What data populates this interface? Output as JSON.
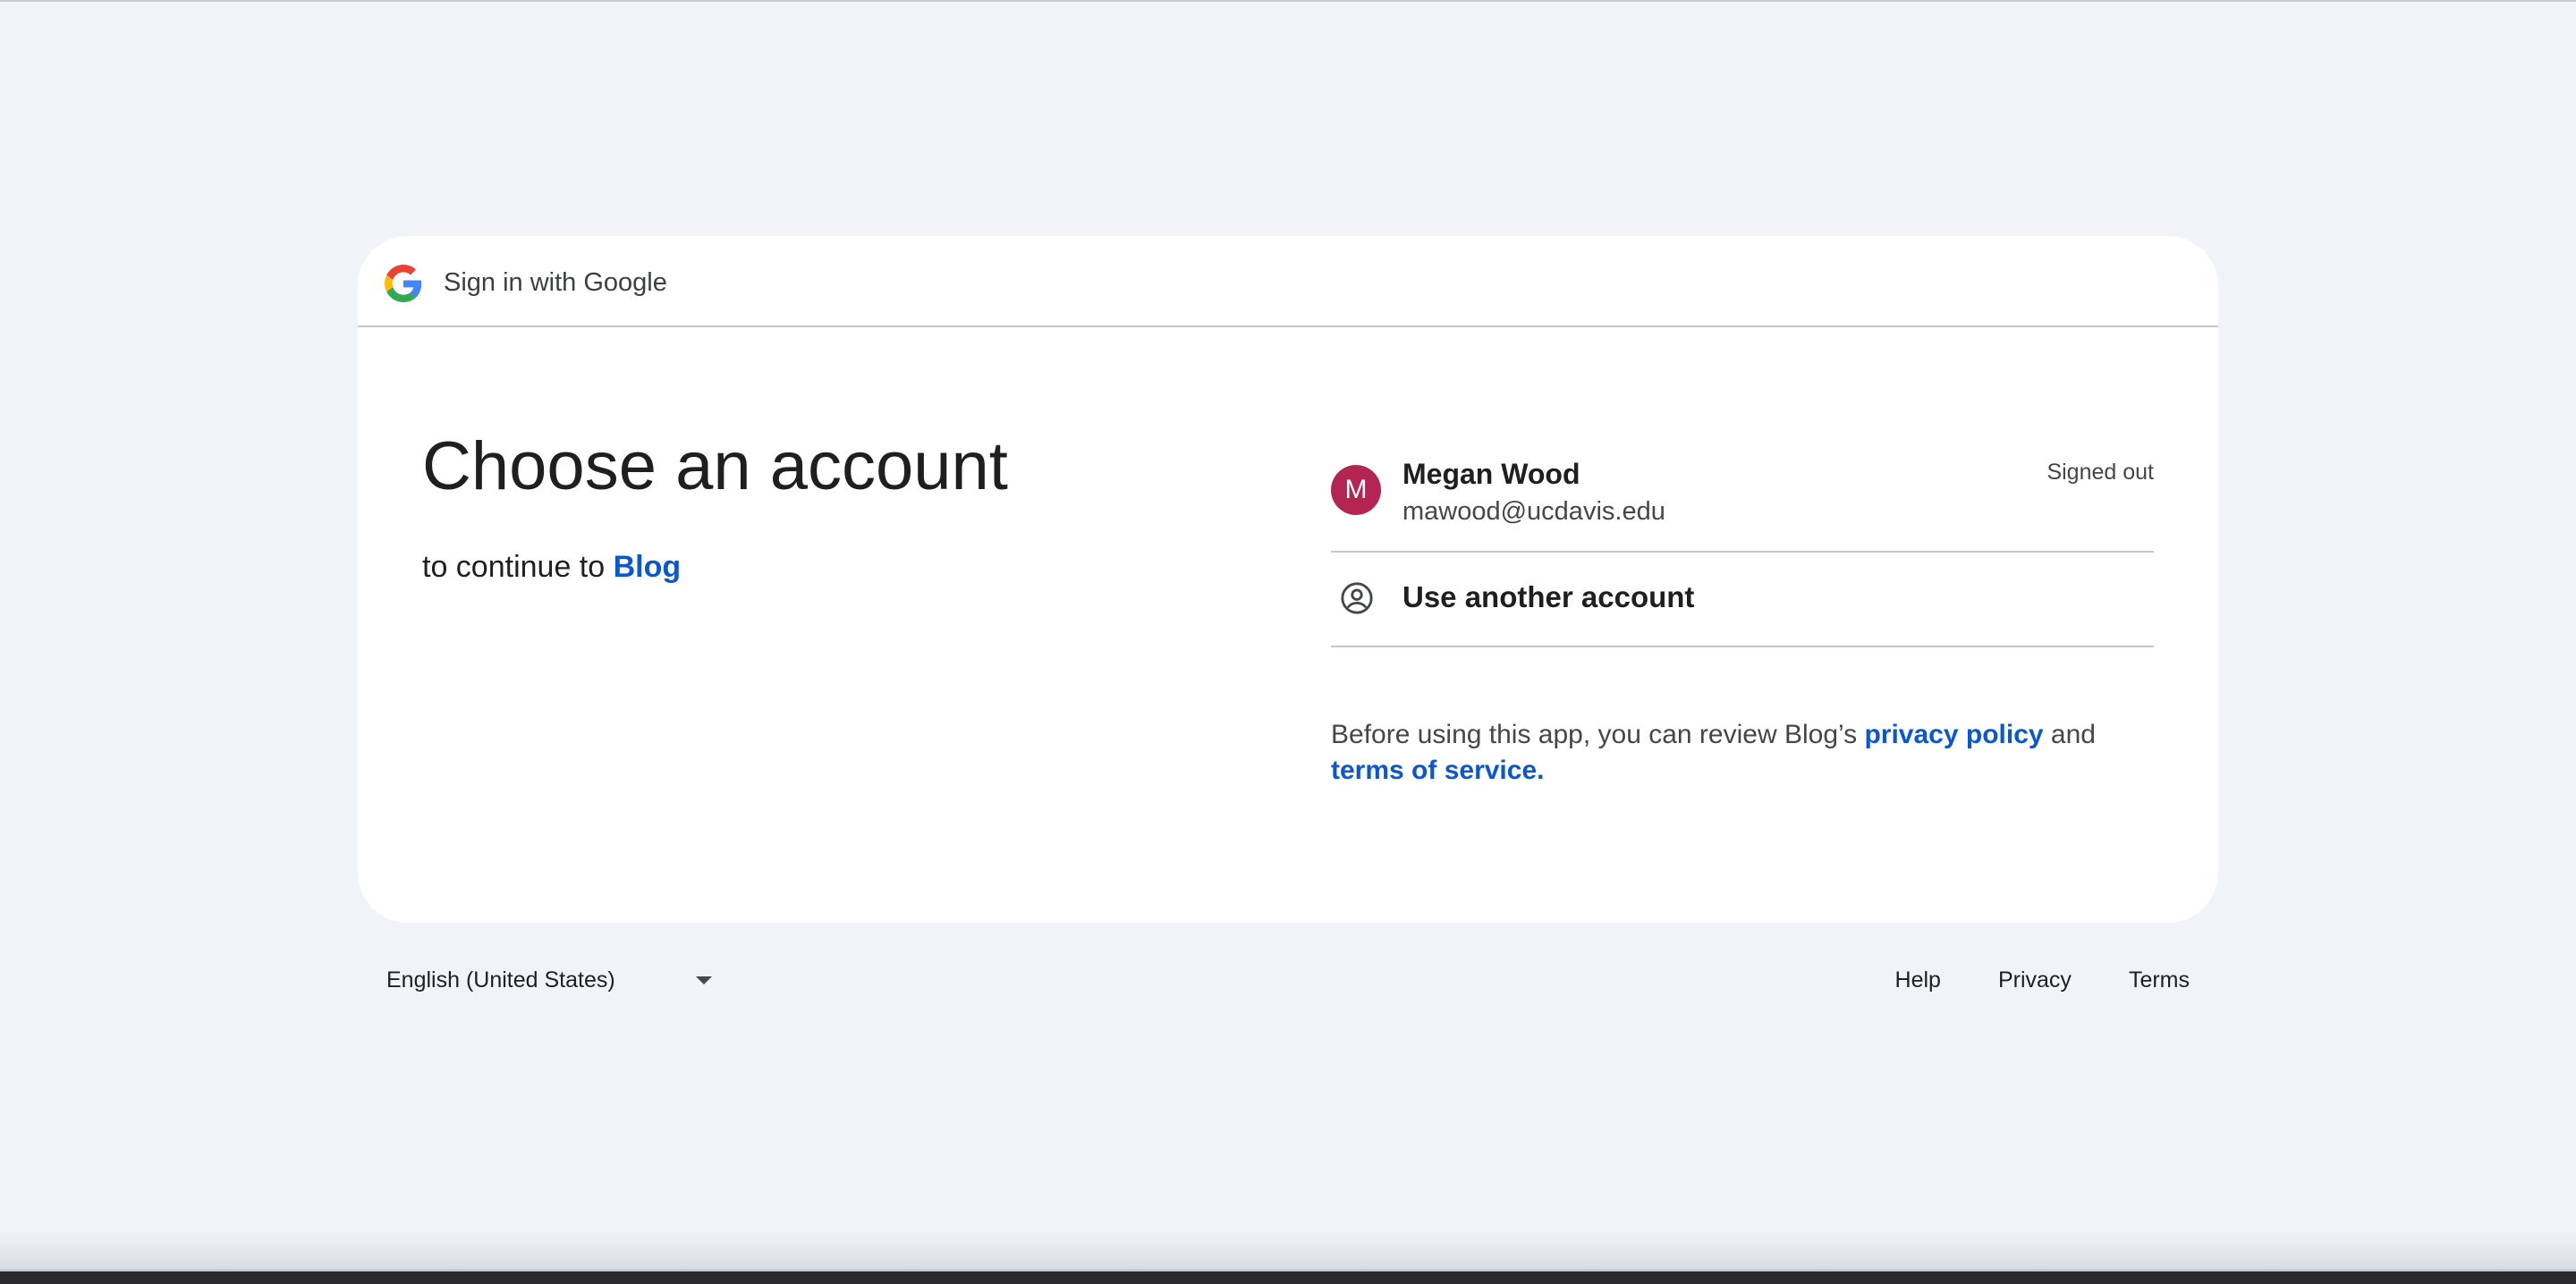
{
  "header": {
    "logo_icon": "google-g-icon",
    "title": "Sign in with Google"
  },
  "main": {
    "heading": "Choose an account",
    "subheading_prefix": "to continue to",
    "app_name": "Blog"
  },
  "accounts": [
    {
      "initial": "M",
      "avatar_color": "#b42553",
      "name": "Megan Wood",
      "email": "mawood@ucdavis.edu",
      "status": "Signed out"
    }
  ],
  "another_account": {
    "icon": "account-circle-icon",
    "label": "Use another account"
  },
  "disclaimer": {
    "prefix": "Before using this app, you can review Blog’s",
    "privacy_link": "privacy policy",
    "middle": "and",
    "terms_link": "terms of service",
    "suffix": "."
  },
  "footer": {
    "language": "English (United States)",
    "language_icon": "caret-down-icon",
    "links": {
      "help": "Help",
      "privacy": "Privacy",
      "terms": "Terms"
    }
  },
  "colors": {
    "page_background": "#f0f4f9",
    "card_background": "#ffffff",
    "link": "#0b57d0",
    "divider": "#c4c7c5"
  }
}
